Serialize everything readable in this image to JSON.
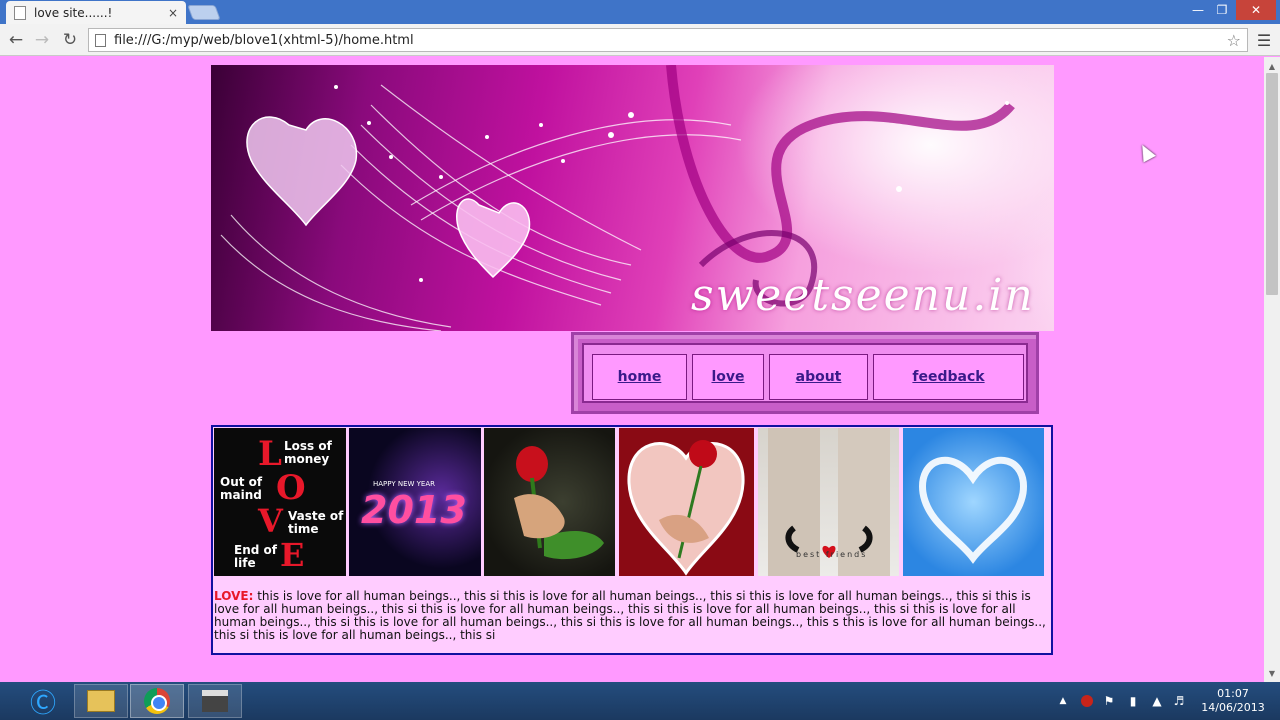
{
  "browser": {
    "tab_title": "love site......!",
    "tab_close": "×",
    "url": "file:///G:/myp/web/blove1(xhtml-5)/home.html",
    "icons": {
      "back": "arrow-left-icon",
      "forward": "arrow-right-icon",
      "reload": "reload-icon",
      "star": "star-icon",
      "menu": "menu-icon"
    },
    "window_controls": {
      "minimize": "—",
      "maximize": "❐",
      "close": "✕"
    }
  },
  "page": {
    "banner": {
      "brand": "sweetseenu.in"
    },
    "nav": [
      {
        "label": "home"
      },
      {
        "label": "love"
      },
      {
        "label": "about"
      },
      {
        "label": "feedback"
      }
    ],
    "gallery": {
      "thumb1": {
        "letters": [
          "L",
          "O",
          "V",
          "E"
        ],
        "phrases": [
          "Loss of money",
          "Out of maind",
          "Vaste of time",
          "End of life"
        ]
      },
      "thumb2": {
        "text": "HAPPY NEW YEAR",
        "year": "2013"
      },
      "thumb5": {
        "text": "best friends"
      }
    },
    "love_label": "LOVE:",
    "love_text": " this is love for all human beings.., this si this is love for all human beings.., this si this is love for all human beings.., this si this is love for all human beings.., this si this is love for all human beings.., this si this is love for all human beings.., this si this is love for all human beings.., this si this is love for all human beings.., this si this is love for all human beings.., this s this is love for all human beings.., this si this is love for all human beings.., this si"
  },
  "taskbar": {
    "clock_time": "01:07",
    "clock_date": "14/06/2013"
  },
  "colors": {
    "page_background": "#ff99ff",
    "nav_link_text": "#3a1a8a",
    "love_label": "#e8182a",
    "content_border": "#1010a0"
  }
}
